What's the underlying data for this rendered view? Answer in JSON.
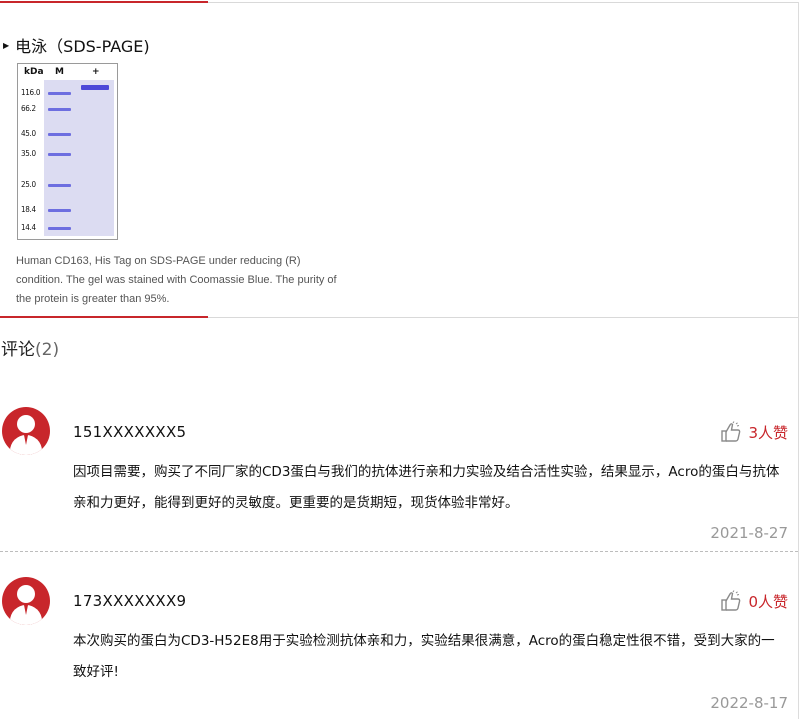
{
  "section": {
    "title": "电泳（SDS-PAGE)",
    "gel": {
      "header_kda": "kDa",
      "header_m": "M",
      "header_plus": "+",
      "markers": [
        "116.0",
        "66.2",
        "45.0",
        "35.0",
        "25.0",
        "18.4",
        "14.4"
      ]
    },
    "caption": "Human CD163, His Tag on SDS-PAGE under reducing (R) condition. The gel was stained with Coomassie Blue. The purity of the protein is greater than 95%."
  },
  "comments": {
    "title": "评论",
    "count": "(2)",
    "items": [
      {
        "user": "151XXXXXXX5",
        "likes": "3人赞",
        "text": "因项目需要，购买了不同厂家的CD3蛋白与我们的抗体进行亲和力实验及结合活性实验，结果显示，Acro的蛋白与抗体亲和力更好，能得到更好的灵敏度。更重要的是货期短，现货体验非常好。",
        "date": "2021-8-27"
      },
      {
        "user": "173XXXXXXX9",
        "likes": "0人赞",
        "text": "本次购买的蛋白为CD3-H52E8用于实验检测抗体亲和力，实验结果很满意，Acro的蛋白稳定性很不错，受到大家的一致好评!",
        "date": "2022-8-17"
      }
    ]
  },
  "colors": {
    "accent": "#c8262b",
    "gel_band": "#6d6ee0",
    "gel_background": "#dcdcf2"
  },
  "icons": {
    "section_marker": "triangle-right-icon",
    "avatar": "user-avatar-icon",
    "like": "thumbs-up-icon"
  }
}
